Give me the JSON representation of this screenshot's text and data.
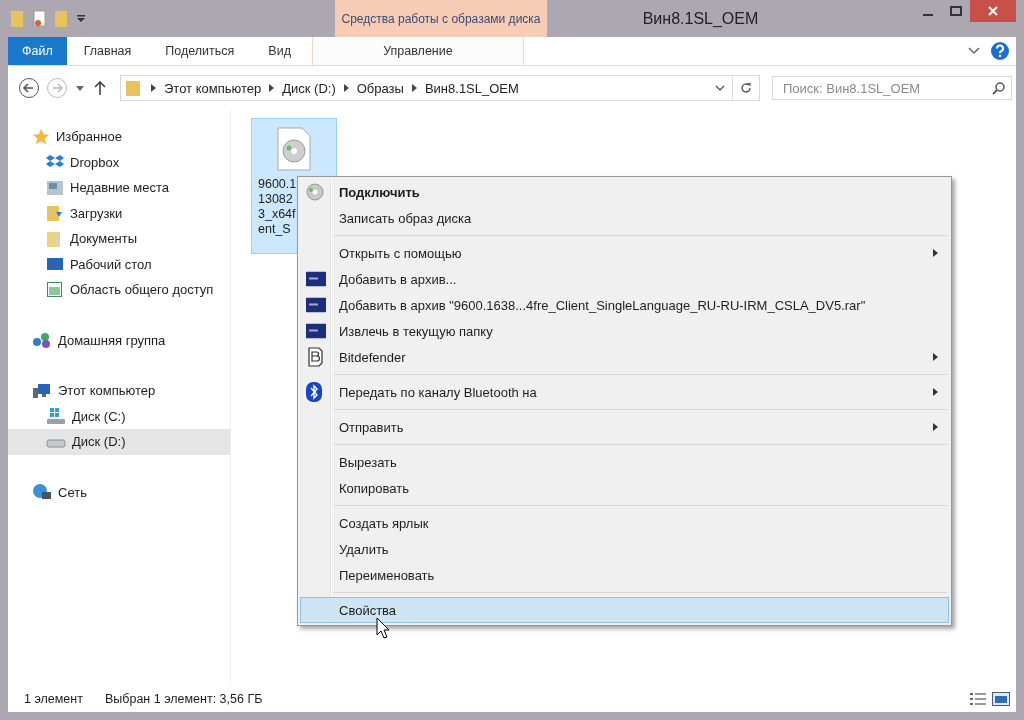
{
  "window": {
    "title": "Вин8.1SL_OEM",
    "contextual_header": "Средства работы с образами диска"
  },
  "ribbon_tabs": [
    {
      "label": "Файл",
      "kind": "file"
    },
    {
      "label": "Главная",
      "kind": "tab"
    },
    {
      "label": "Поделиться",
      "kind": "tab"
    },
    {
      "label": "Вид",
      "kind": "tab"
    },
    {
      "label": "Управление",
      "kind": "contextual"
    }
  ],
  "address": {
    "path": [
      "Этот компьютер",
      "Диск (D:)",
      "Образы",
      "Вин8.1SL_OEM"
    ],
    "search_placeholder": "Поиск: Вин8.1SL_OEM"
  },
  "sidebar": {
    "items": [
      {
        "label": "Избранное",
        "kind": "star",
        "selected": false,
        "children": [
          {
            "label": "Dropbox",
            "kind": "dropbox",
            "selected": false
          },
          {
            "label": "Недавние места",
            "kind": "recent",
            "selected": false
          },
          {
            "label": "Загрузки",
            "kind": "downloads",
            "selected": false
          },
          {
            "label": "Документы",
            "kind": "folder",
            "selected": false
          },
          {
            "label": "Рабочий стол",
            "kind": "desktop",
            "selected": false
          },
          {
            "label": "Область общего доступ",
            "kind": "share",
            "selected": false
          }
        ]
      },
      {
        "label": "Домашняя группа",
        "kind": "homegroup",
        "selected": false
      },
      {
        "label": "Этот компьютер",
        "kind": "computer",
        "selected": false,
        "children": [
          {
            "label": "Диск (C:)",
            "kind": "windrive",
            "selected": false
          },
          {
            "label": "Диск (D:)",
            "kind": "drive",
            "selected": true
          }
        ]
      },
      {
        "label": "Сеть",
        "kind": "network",
        "selected": false
      }
    ]
  },
  "file": {
    "label_lines": [
      "9600.1",
      "13082",
      "3_x64f",
      "ent_S"
    ],
    "selected": true
  },
  "context_menu": {
    "groups": [
      [
        {
          "label": "Подключить",
          "kind": "disc",
          "default": true,
          "submenu": false,
          "selected": false
        },
        {
          "label": "Записать образ диска",
          "kind": "plain",
          "default": false,
          "submenu": false,
          "selected": false
        }
      ],
      [
        {
          "label": "Открыть с помощью",
          "kind": "plain",
          "default": false,
          "submenu": true,
          "selected": false
        },
        {
          "label": "Добавить в архив...",
          "kind": "archive",
          "default": false,
          "submenu": false,
          "selected": false
        },
        {
          "label": "Добавить в архив \"9600.1638...4fre_Client_SingleLanguage_RU-RU-IRM_CSLA_DV5.rar\"",
          "kind": "archive",
          "default": false,
          "submenu": false,
          "selected": false
        },
        {
          "label": "Извлечь в текущую папку",
          "kind": "archive",
          "default": false,
          "submenu": false,
          "selected": false
        },
        {
          "label": "Bitdefender",
          "kind": "bitdefender",
          "default": false,
          "submenu": true,
          "selected": false
        }
      ],
      [
        {
          "label": "Передать по каналу Bluetooth на",
          "kind": "bluetooth",
          "default": false,
          "submenu": true,
          "selected": false
        }
      ],
      [
        {
          "label": "Отправить",
          "kind": "plain",
          "default": false,
          "submenu": true,
          "selected": false
        }
      ],
      [
        {
          "label": "Вырезать",
          "kind": "plain",
          "default": false,
          "submenu": false,
          "selected": false
        },
        {
          "label": "Копировать",
          "kind": "plain",
          "default": false,
          "submenu": false,
          "selected": false
        }
      ],
      [
        {
          "label": "Создать ярлык",
          "kind": "plain",
          "default": false,
          "submenu": false,
          "selected": false
        },
        {
          "label": "Удалить",
          "kind": "plain",
          "default": false,
          "submenu": false,
          "selected": false
        },
        {
          "label": "Переименовать",
          "kind": "plain",
          "default": false,
          "submenu": false,
          "selected": false
        }
      ],
      [
        {
          "label": "Свойства",
          "kind": "plain",
          "default": false,
          "submenu": false,
          "selected": true
        }
      ]
    ]
  },
  "status_bar": {
    "count": "1 элемент",
    "selection": "Выбран 1 элемент: 3,56 ГБ"
  }
}
